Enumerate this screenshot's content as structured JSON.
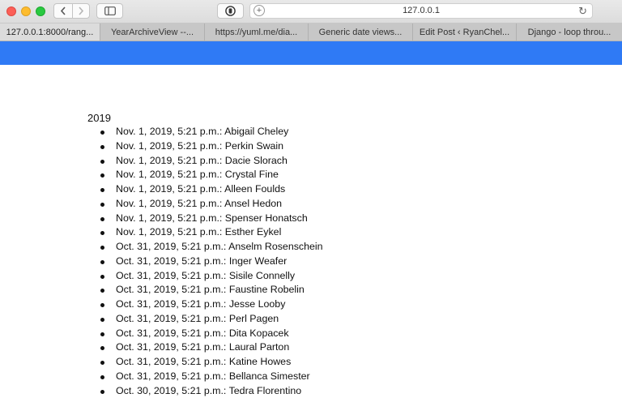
{
  "browser": {
    "url": "127.0.0.1",
    "tabs": [
      {
        "label": "127.0.0.1:8000/rang..."
      },
      {
        "label": "YearArchiveView --..."
      },
      {
        "label": "https://yuml.me/dia..."
      },
      {
        "label": "Generic date views..."
      },
      {
        "label": "Edit Post ‹ RyanChel..."
      },
      {
        "label": "Django - loop throu..."
      }
    ]
  },
  "page": {
    "year": "2019",
    "entries": [
      {
        "text": "Nov. 1, 2019, 5:21 p.m.: Abigail Cheley"
      },
      {
        "text": "Nov. 1, 2019, 5:21 p.m.: Perkin Swain"
      },
      {
        "text": "Nov. 1, 2019, 5:21 p.m.: Dacie Slorach"
      },
      {
        "text": "Nov. 1, 2019, 5:21 p.m.: Crystal Fine"
      },
      {
        "text": "Nov. 1, 2019, 5:21 p.m.: Alleen Foulds"
      },
      {
        "text": "Nov. 1, 2019, 5:21 p.m.: Ansel Hedon"
      },
      {
        "text": "Nov. 1, 2019, 5:21 p.m.: Spenser Honatsch"
      },
      {
        "text": "Nov. 1, 2019, 5:21 p.m.: Esther Eykel"
      },
      {
        "text": "Oct. 31, 2019, 5:21 p.m.: Anselm Rosenschein"
      },
      {
        "text": "Oct. 31, 2019, 5:21 p.m.: Inger Weafer"
      },
      {
        "text": "Oct. 31, 2019, 5:21 p.m.: Sisile Connelly"
      },
      {
        "text": "Oct. 31, 2019, 5:21 p.m.: Faustine Robelin"
      },
      {
        "text": "Oct. 31, 2019, 5:21 p.m.: Jesse Looby"
      },
      {
        "text": "Oct. 31, 2019, 5:21 p.m.: Perl Pagen"
      },
      {
        "text": "Oct. 31, 2019, 5:21 p.m.: Dita Kopacek"
      },
      {
        "text": "Oct. 31, 2019, 5:21 p.m.: Laural Parton"
      },
      {
        "text": "Oct. 31, 2019, 5:21 p.m.: Katine Howes"
      },
      {
        "text": "Oct. 31, 2019, 5:21 p.m.: Bellanca Simester"
      },
      {
        "text": "Oct. 30, 2019, 5:21 p.m.: Tedra Florentino"
      }
    ]
  },
  "icons": {
    "back": "chevron-left-icon",
    "forward": "chevron-right-icon",
    "sidebar": "sidebar-icon",
    "privacy": "privacy-report-icon",
    "new_tab": "plus-icon",
    "reload": "reload-icon"
  },
  "colors": {
    "accent_bar": "#2f7af5"
  }
}
